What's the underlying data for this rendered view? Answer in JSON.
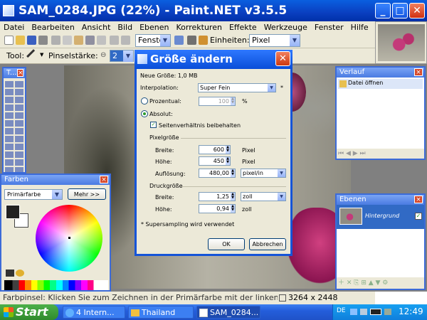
{
  "window": {
    "title": "SAM_0284.JPG (22%) - Paint.NET v3.5.5",
    "btn_min": "_",
    "btn_max": "□",
    "btn_close": "✕"
  },
  "menu": [
    "Datei",
    "Bearbeiten",
    "Ansicht",
    "Bild",
    "Ebenen",
    "Korrekturen",
    "Effekte",
    "Werkzeuge",
    "Fenster",
    "Hilfe"
  ],
  "toolbar1": {
    "window_combo": "Fenster",
    "units_label": "Einheiten:",
    "units_value": "Pixel"
  },
  "toolbar2": {
    "tool_label": "Tool:",
    "brush_label": "Pinselstärke:",
    "brush_value": "2"
  },
  "tools_panel": {
    "title": "T..."
  },
  "colors_panel": {
    "title": "Farben",
    "mode": "Primärfarbe",
    "more_button": "Mehr >>"
  },
  "history_panel": {
    "title": "Verlauf",
    "item": "Datei öffnen"
  },
  "layers_panel": {
    "title": "Ebenen",
    "layer_name": "Hintergrund"
  },
  "dialog": {
    "title": "Größe ändern",
    "new_size": "Neue Größe: 1,0 MB",
    "interpolation_label": "Interpolation:",
    "interpolation_value": "Super Fein",
    "percent_label": "Prozentual:",
    "percent_value": "100",
    "percent_unit": "%",
    "absolute_label": "Absolut:",
    "keep_ratio_label": "Seitenverhältnis beibehalten",
    "pixel_size_label": "Pixelgröße",
    "width_label": "Breite:",
    "width_value": "600",
    "width_unit": "Pixel",
    "height_label": "Höhe:",
    "height_value": "450",
    "height_unit": "Pixel",
    "resolution_label": "Auflösung:",
    "resolution_value": "480,00",
    "resolution_unit": "pixel/in",
    "print_size_label": "Druckgröße",
    "print_width_label": "Breite:",
    "print_width_value": "1,25",
    "print_width_unit": "zoll",
    "print_height_label": "Höhe:",
    "print_height_value": "0,94",
    "print_height_unit": "zoll",
    "note": "* Supersampling wird verwendet",
    "ok": "OK",
    "cancel": "Abbrechen",
    "star": "*"
  },
  "status": {
    "text": "Farbpinsel: Klicken Sie zum Zeichnen in der Primärfarbe mit der linken und",
    "size": "3264 x 2448"
  },
  "taskbar": {
    "start": "Start",
    "tasks": [
      "4 Intern...",
      "Thailand",
      "SAM_0284..."
    ],
    "lang": "DE",
    "clock": "12:49"
  },
  "colors": {
    "titlebar": "#0a4ed8",
    "accent": "#2e78ff",
    "taskbar": "#245edb",
    "start": "#3a9a38"
  }
}
